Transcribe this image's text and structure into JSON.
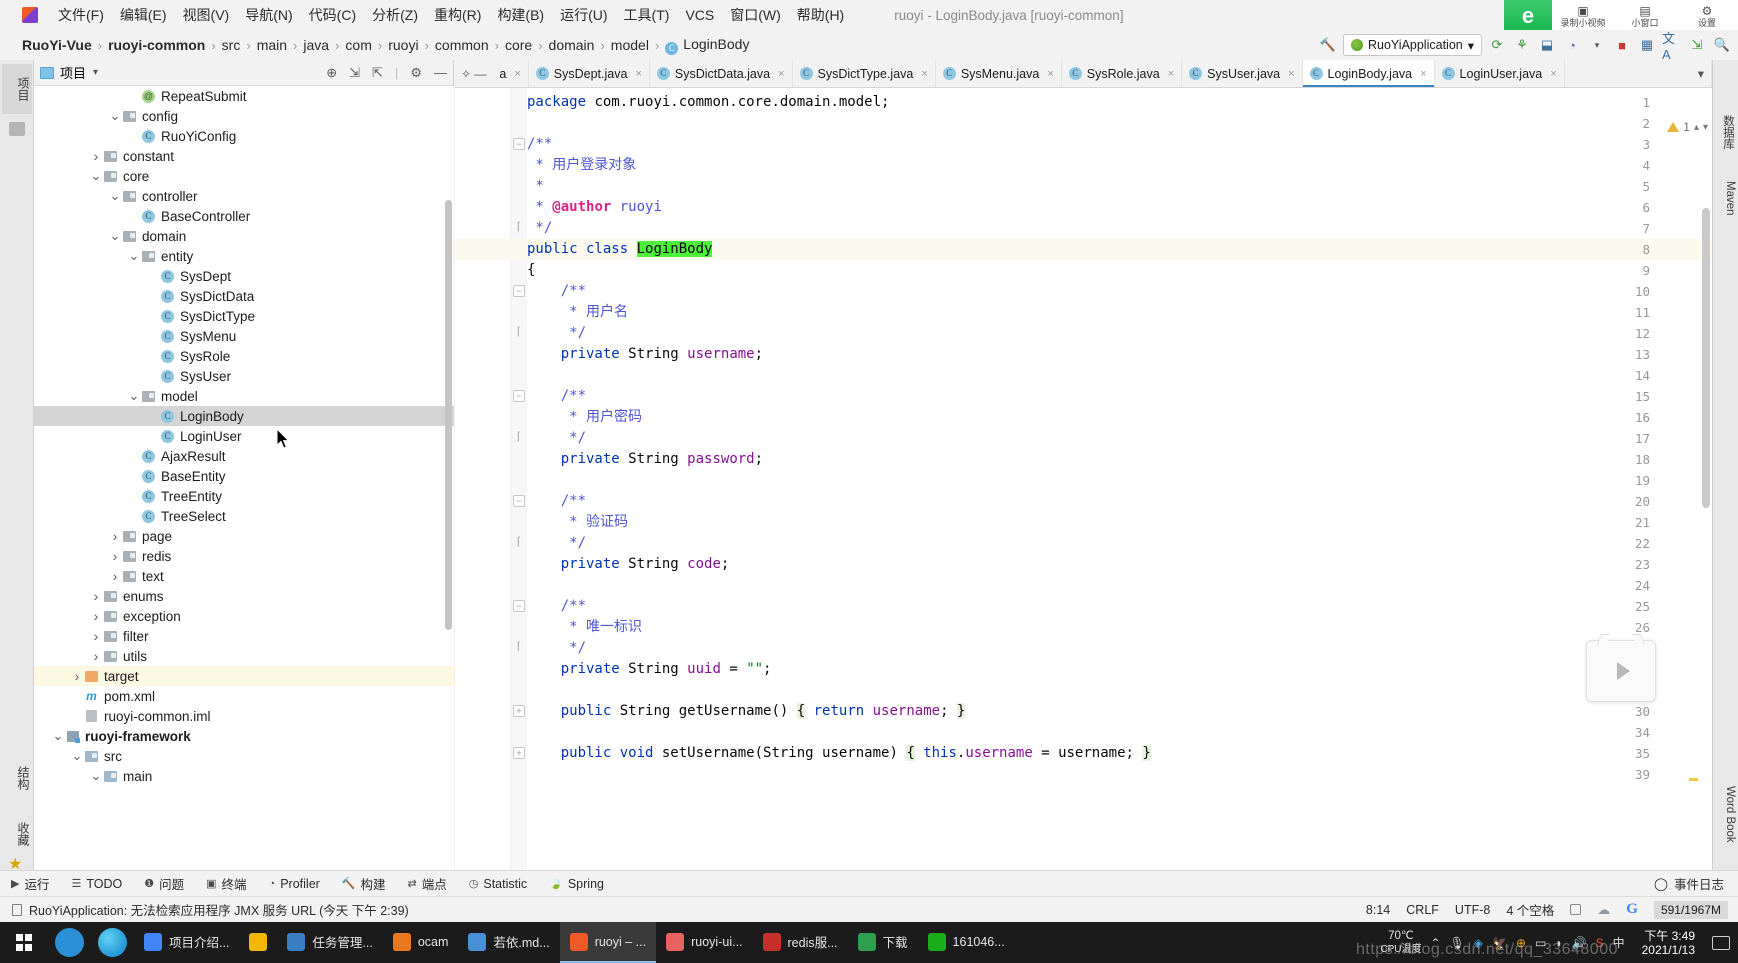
{
  "menubar": {
    "items": [
      {
        "label": "文件(F)"
      },
      {
        "label": "编辑(E)"
      },
      {
        "label": "视图(V)"
      },
      {
        "label": "导航(N)"
      },
      {
        "label": "代码(C)"
      },
      {
        "label": "分析(Z)"
      },
      {
        "label": "重构(R)"
      },
      {
        "label": "构建(B)"
      },
      {
        "label": "运行(U)"
      },
      {
        "label": "工具(T)"
      },
      {
        "label": "VCS"
      },
      {
        "label": "窗口(W)"
      },
      {
        "label": "帮助(H)"
      }
    ],
    "window_title": "ruoyi - LoginBody.java [ruoyi-common]"
  },
  "recorder": {
    "logo": "e",
    "buttons": [
      {
        "label": "录制小视频",
        "icon": "record-video-icon"
      },
      {
        "label": "小窗口",
        "icon": "mini-window-icon"
      },
      {
        "label": "设置",
        "icon": "settings-gear-icon"
      }
    ]
  },
  "breadcrumb": {
    "items": [
      "RuoYi-Vue",
      "ruoyi-common",
      "src",
      "main",
      "java",
      "com",
      "ruoyi",
      "common",
      "core",
      "domain",
      "model"
    ],
    "leaf": "LoginBody",
    "separator": "›"
  },
  "toolbar": {
    "run_config": "RuoYiApplication",
    "dropdown_caret": "▾",
    "icons": [
      "build-hammer-icon",
      "reload-icon",
      "bug-icon",
      "debug-step-icon",
      "coverage-icon",
      "stop-icon",
      "layout-icon",
      "translate-icon",
      "update-icon",
      "search-everywhere-icon"
    ]
  },
  "left_strips": {
    "top_tabs": [
      {
        "label": "项目",
        "selected": true
      }
    ],
    "bottom_tabs": [
      {
        "label": "结构"
      },
      {
        "label": "收藏"
      }
    ]
  },
  "right_strips": {
    "tabs": [
      {
        "label": "数据库"
      },
      {
        "label": "Maven"
      },
      {
        "label": "Word Book"
      }
    ]
  },
  "project_panel": {
    "title": "项目",
    "caret": "▾",
    "header_icons": [
      "locate-icon",
      "expand-all-icon",
      "collapse-all-icon",
      "settings-gear-icon",
      "hide-icon"
    ],
    "tree": [
      {
        "indent": 4,
        "twist": "",
        "icon": "annotation",
        "label": "RepeatSubmit"
      },
      {
        "indent": 3,
        "twist": "v",
        "icon": "folder",
        "label": "config"
      },
      {
        "indent": 4,
        "twist": "",
        "icon": "class",
        "label": "RuoYiConfig"
      },
      {
        "indent": 2,
        "twist": ">",
        "icon": "folder",
        "label": "constant"
      },
      {
        "indent": 2,
        "twist": "v",
        "icon": "folder",
        "label": "core"
      },
      {
        "indent": 3,
        "twist": "v",
        "icon": "folder",
        "label": "controller"
      },
      {
        "indent": 4,
        "twist": "",
        "icon": "class",
        "label": "BaseController"
      },
      {
        "indent": 3,
        "twist": "v",
        "icon": "folder",
        "label": "domain"
      },
      {
        "indent": 4,
        "twist": "v",
        "icon": "folder",
        "label": "entity"
      },
      {
        "indent": 5,
        "twist": "",
        "icon": "class",
        "label": "SysDept"
      },
      {
        "indent": 5,
        "twist": "",
        "icon": "class",
        "label": "SysDictData"
      },
      {
        "indent": 5,
        "twist": "",
        "icon": "class",
        "label": "SysDictType"
      },
      {
        "indent": 5,
        "twist": "",
        "icon": "class",
        "label": "SysMenu"
      },
      {
        "indent": 5,
        "twist": "",
        "icon": "class",
        "label": "SysRole"
      },
      {
        "indent": 5,
        "twist": "",
        "icon": "class",
        "label": "SysUser"
      },
      {
        "indent": 4,
        "twist": "v",
        "icon": "folder",
        "label": "model"
      },
      {
        "indent": 5,
        "twist": "",
        "icon": "class",
        "label": "LoginBody",
        "state": "selected"
      },
      {
        "indent": 5,
        "twist": "",
        "icon": "class",
        "label": "LoginUser"
      },
      {
        "indent": 4,
        "twist": "",
        "icon": "class",
        "label": "AjaxResult"
      },
      {
        "indent": 4,
        "twist": "",
        "icon": "class",
        "label": "BaseEntity"
      },
      {
        "indent": 4,
        "twist": "",
        "icon": "class",
        "label": "TreeEntity"
      },
      {
        "indent": 4,
        "twist": "",
        "icon": "class",
        "label": "TreeSelect"
      },
      {
        "indent": 3,
        "twist": ">",
        "icon": "folder",
        "label": "page"
      },
      {
        "indent": 3,
        "twist": ">",
        "icon": "folder",
        "label": "redis"
      },
      {
        "indent": 3,
        "twist": ">",
        "icon": "folder",
        "label": "text"
      },
      {
        "indent": 2,
        "twist": ">",
        "icon": "folder",
        "label": "enums"
      },
      {
        "indent": 2,
        "twist": ">",
        "icon": "folder",
        "label": "exception"
      },
      {
        "indent": 2,
        "twist": ">",
        "icon": "folder",
        "label": "filter"
      },
      {
        "indent": 2,
        "twist": ">",
        "icon": "folder",
        "label": "utils"
      },
      {
        "indent": 1,
        "twist": ">",
        "icon": "folder-orange",
        "label": "target",
        "state": "highlight"
      },
      {
        "indent": 1,
        "twist": "",
        "icon": "maven",
        "label": "pom.xml"
      },
      {
        "indent": 1,
        "twist": "",
        "icon": "iml",
        "label": "ruoyi-common.iml"
      },
      {
        "indent": 0,
        "twist": "v",
        "icon": "module",
        "label": "ruoyi-framework",
        "bold": true
      },
      {
        "indent": 1,
        "twist": "v",
        "icon": "folder-blue",
        "label": "src"
      },
      {
        "indent": 2,
        "twist": "v",
        "icon": "folder-blue",
        "label": "main"
      }
    ]
  },
  "editor": {
    "tabs": [
      {
        "label": "a",
        "icon": "",
        "active": false
      },
      {
        "label": "SysDept.java",
        "icon": "class",
        "active": false
      },
      {
        "label": "SysDictData.java",
        "icon": "class",
        "active": false
      },
      {
        "label": "SysDictType.java",
        "icon": "class",
        "active": false
      },
      {
        "label": "SysMenu.java",
        "icon": "class",
        "active": false
      },
      {
        "label": "SysRole.java",
        "icon": "class",
        "active": false
      },
      {
        "label": "SysUser.java",
        "icon": "class",
        "active": false
      },
      {
        "label": "LoginBody.java",
        "icon": "class",
        "active": true
      },
      {
        "label": "LoginUser.java",
        "icon": "class",
        "active": false
      }
    ],
    "tab_close": "×",
    "tab_overflow": "▾",
    "inspection_count": "1",
    "lines": [
      {
        "n": 1,
        "html": "<span class=\"kw\">package</span> com.ruoyi.common.core.domain.model;",
        "indent": 0
      },
      {
        "n": 2,
        "html": "",
        "indent": 0
      },
      {
        "n": 3,
        "html": "<span class=\"cm\">/**</span>",
        "fold": "minus"
      },
      {
        "n": 4,
        "html": "<span class=\"cm\"> * 用户登录对象</span>"
      },
      {
        "n": 5,
        "html": "<span class=\"cm\"> *</span>"
      },
      {
        "n": 6,
        "html": "<span class=\"cm\"> * </span><span class=\"cmtag\">@author</span><span class=\"cm\"> ruoyi</span>"
      },
      {
        "n": 7,
        "html": "<span class=\"cm\"> */</span>",
        "fold": "end"
      },
      {
        "n": 8,
        "html": "<span class=\"kw\">public class</span> <span class=\"hl-green\">LoginBody</span>",
        "current": true
      },
      {
        "n": 9,
        "html": "{"
      },
      {
        "n": 10,
        "html": "    <span class=\"cm\">/**</span>",
        "fold": "minus"
      },
      {
        "n": 11,
        "html": "     <span class=\"cm\">* 用户名</span>"
      },
      {
        "n": 12,
        "html": "     <span class=\"cm\">*/</span>",
        "fold": "end"
      },
      {
        "n": 13,
        "html": "    <span class=\"kw\">private</span> String <span class=\"fld\">username</span>;"
      },
      {
        "n": 14,
        "html": ""
      },
      {
        "n": 15,
        "html": "    <span class=\"cm\">/**</span>",
        "fold": "minus"
      },
      {
        "n": 16,
        "html": "     <span class=\"cm\">* 用户密码</span>"
      },
      {
        "n": 17,
        "html": "     <span class=\"cm\">*/</span>",
        "fold": "end"
      },
      {
        "n": 18,
        "html": "    <span class=\"kw\">private</span> String <span class=\"fld\">password</span>;"
      },
      {
        "n": 19,
        "html": ""
      },
      {
        "n": 20,
        "html": "    <span class=\"cm\">/**</span>",
        "fold": "minus"
      },
      {
        "n": 21,
        "html": "     <span class=\"cm\">* 验证码</span>"
      },
      {
        "n": 22,
        "html": "     <span class=\"cm\">*/</span>",
        "fold": "end"
      },
      {
        "n": 23,
        "html": "    <span class=\"kw\">private</span> String <span class=\"fld\">code</span>;"
      },
      {
        "n": 24,
        "html": ""
      },
      {
        "n": 25,
        "html": "    <span class=\"cm\">/**</span>",
        "fold": "minus"
      },
      {
        "n": 26,
        "html": "     <span class=\"cm\">* 唯一标识</span>"
      },
      {
        "n": 27,
        "html": "     <span class=\"cm\">*/</span>",
        "fold": "end"
      },
      {
        "n": 28,
        "html": "    <span class=\"kw\">private</span> String <span class=\"fld\">uuid</span> = <span class=\"str\">\"\"</span>;"
      },
      {
        "n": 29,
        "html": ""
      },
      {
        "n": 30,
        "html": "    <span class=\"kw\">public</span> String getUsername() <span class=\"brace-hl\">{</span> <span class=\"kw\">return</span> <span class=\"fld\">username</span>; <span class=\"brace-hl\">}</span>",
        "fold": "plus"
      },
      {
        "n": 34,
        "html": ""
      },
      {
        "n": 35,
        "html": "    <span class=\"kw\">public void</span> setUsername(String username) <span class=\"brace-hl\">{</span> <span class=\"kw\">this</span>.<span class=\"fld\">username</span> = username; <span class=\"brace-hl\">}</span>",
        "fold": "plus"
      },
      {
        "n": 39,
        "html": ""
      }
    ],
    "source_text": "package com.ruoyi.common.core.domain.model;\n\n/**\n * 用户登录对象\n *\n * @author ruoyi\n */\npublic class LoginBody\n{\n    /**\n     * 用户名\n     */\n    private String username;\n\n    /**\n     * 用户密码\n     */\n    private String password;\n\n    /**\n     * 验证码\n     */\n    private String code;\n\n    /**\n     * 唯一标识\n     */\n    private String uuid = \"\";\n\n    public String getUsername() { return username; }\n\n    public void setUsername(String username) { this.username = username; }\n"
  },
  "bottom_toolwindows": [
    {
      "label": "运行",
      "icon": "play-icon"
    },
    {
      "label": "TODO",
      "icon": "todo-list-icon"
    },
    {
      "label": "问题",
      "icon": "problems-icon"
    },
    {
      "label": "终端",
      "icon": "terminal-icon"
    },
    {
      "label": "Profiler",
      "icon": "profiler-icon"
    },
    {
      "label": "构建",
      "icon": "build-hammer-icon"
    },
    {
      "label": "端点",
      "icon": "endpoints-icon"
    },
    {
      "label": "Statistic",
      "icon": "statistic-icon"
    },
    {
      "label": "Spring",
      "icon": "spring-leaf-icon"
    }
  ],
  "bottom_right": {
    "label": "事件日志",
    "icon": "event-log-icon"
  },
  "statusbar": {
    "message": "RuoYiApplication: 无法检索应用程序 JMX 服务 URL (今天 下午 2:39)",
    "caret": "8:14",
    "line_sep": "CRLF",
    "encoding": "UTF-8",
    "indent": "4 个空格",
    "memory": "591/1967M",
    "icons": [
      "lock-icon",
      "cloud-sync-icon",
      "google-icon"
    ]
  },
  "taskbar": {
    "start": "start-icon",
    "pinned": [
      {
        "name": "cortana-icon",
        "color": "#2b8fd6"
      },
      {
        "name": "edge-icon",
        "color": "#1ea7e1"
      }
    ],
    "apps": [
      {
        "label": "项目介绍...",
        "icon": "chrome-icon",
        "color": "#4285f4",
        "active": false
      },
      {
        "label": "",
        "icon": "chrome-icon",
        "color": "#f2b705",
        "active": false
      },
      {
        "label": "任务管理...",
        "icon": "task-mgr-icon",
        "color": "#3a7fc1",
        "active": false
      },
      {
        "label": "ocam",
        "icon": "ocam-icon",
        "color": "#e8781f",
        "active": false
      },
      {
        "label": "若依.md...",
        "icon": "typora-icon",
        "color": "#4a90d9",
        "active": false
      },
      {
        "label": "ruoyi – ...",
        "icon": "idea-icon",
        "color": "#f05a28",
        "active": true
      },
      {
        "label": "ruoyi-ui...",
        "icon": "idea-icon",
        "color": "#e8615e",
        "active": false
      },
      {
        "label": "redis服...",
        "icon": "redis-icon",
        "color": "#c6302b",
        "active": false
      },
      {
        "label": "下载",
        "icon": "download-icon",
        "color": "#2f9e4f",
        "active": false
      },
      {
        "label": "161046...",
        "icon": "wechat-icon",
        "color": "#1aad19",
        "active": false
      }
    ],
    "cpu_temp": {
      "value": "70℃",
      "label": "CPU温度"
    },
    "tray_icons": [
      "chevron-up-icon",
      "microphone-icon",
      "onedrive-icon",
      "thunderbird-icon",
      "security-icon",
      "battery-icon",
      "wifi-icon",
      "volume-icon",
      "input-method-icon",
      "sogou-icon"
    ],
    "clock": {
      "time": "下午 3:49",
      "date": "2021/1/13"
    },
    "notification": "notification-icon",
    "watermark": "https://blog.csdn.net/qq_33648000"
  }
}
